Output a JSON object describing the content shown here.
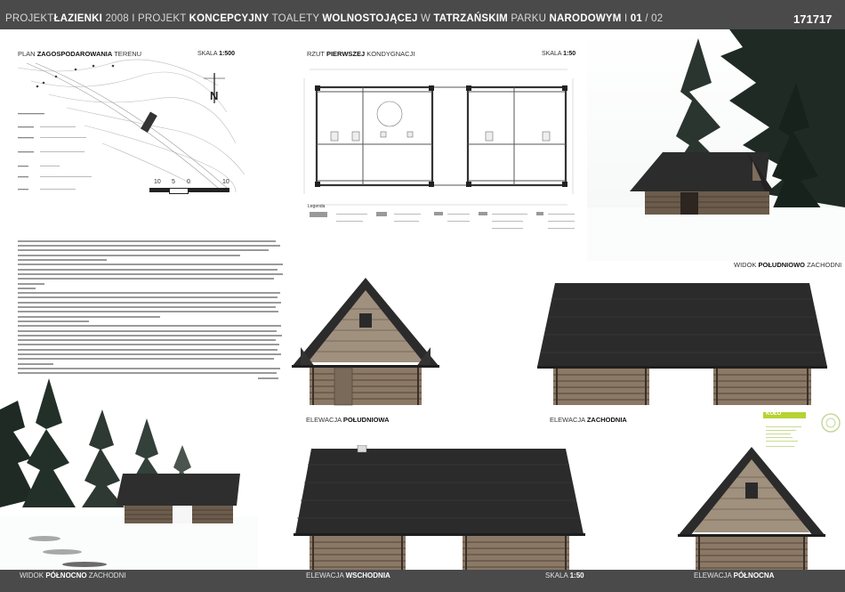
{
  "header": {
    "parts": [
      {
        "t": "PROJEKT",
        "b": false
      },
      {
        "t": "ŁAZIENKI",
        "b": true
      },
      {
        "t": " 2008 I PROJEKT ",
        "b": false
      },
      {
        "t": "KONCEPCYJNY",
        "b": true
      },
      {
        "t": " TOALETY ",
        "b": false
      },
      {
        "t": "WOLNOSTOJĄCEJ",
        "b": true
      },
      {
        "t": " W ",
        "b": false
      },
      {
        "t": "TATRZAŃSKIM",
        "b": true
      },
      {
        "t": " PARKU ",
        "b": false
      },
      {
        "t": "NARODOWYM",
        "b": true
      },
      {
        "t": " I ",
        "b": false
      },
      {
        "t": "01",
        "b": true
      },
      {
        "t": " / 02",
        "b": false
      }
    ],
    "code": "171717"
  },
  "site_plan": {
    "title_pre": "PLAN ",
    "title_bold": "ZAGOSPODAROWANIA",
    "title_post": " TERENU",
    "scale_pre": "SKALA ",
    "scale_bold": "1:500",
    "north": "N",
    "scalebar": [
      "10",
      "5",
      "0",
      "10"
    ]
  },
  "floor_plan": {
    "title_pre": "RZUT ",
    "title_bold": "PIERWSZEJ",
    "title_post": " KONDYGNACJI",
    "scale_pre": "SKALA ",
    "scale_bold": "1:50",
    "legend_title": "Legenda"
  },
  "views": {
    "sw_pre": "WIDOK ",
    "sw_bold": "POŁUDNIOWO",
    "sw_post": " ZACHODNI",
    "south_pre": "ELEWACJA ",
    "south_bold": "POŁUDNIOWA",
    "west_pre": "ELEWACJA ",
    "west_bold": "ZACHODNIA"
  },
  "footer": {
    "nw_pre": "WIDOK ",
    "nw_bold": "PÓŁNOCNO",
    "nw_post": " ZACHODNI",
    "east_pre": "ELEWACJA ",
    "east_bold": "WSCHODNIA",
    "scale_pre": "SKALA ",
    "scale_bold": "1:50",
    "north_pre": "ELEWACJA ",
    "north_bold": "PÓŁNOCNA"
  },
  "logo": {
    "name": "KOŁO"
  },
  "colors": {
    "header_bg": "#4a4a4a",
    "roof": "#2b2b2b",
    "logs": "#7a6a58",
    "accent": "#b5d334"
  }
}
